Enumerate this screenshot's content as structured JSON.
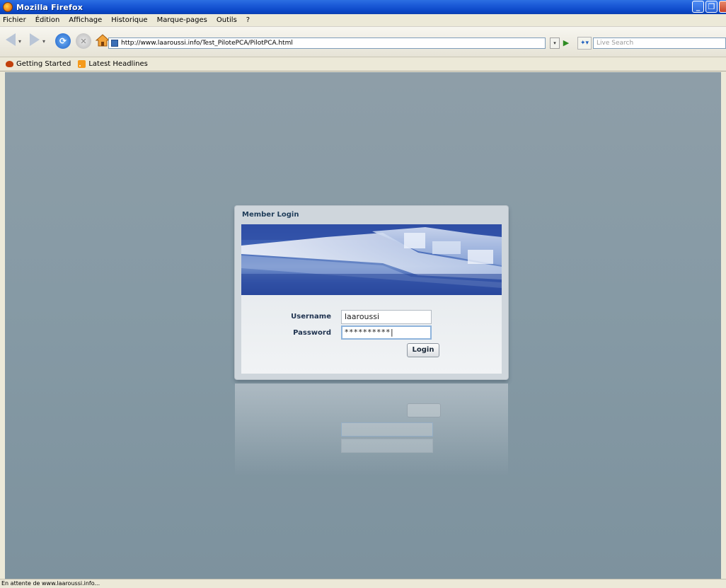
{
  "window": {
    "title": "Mozilla Firefox",
    "buttons": [
      "_",
      "❐",
      "✕"
    ]
  },
  "menubar": {
    "items": [
      "Fichier",
      "Édition",
      "Affichage",
      "Historique",
      "Marque-pages",
      "Outils",
      "?"
    ]
  },
  "toolbar": {
    "url": "http://www.laaroussi.info/Test_PilotePCA/PilotPCA.html",
    "search_placeholder": "Live Search"
  },
  "bookmarks": {
    "items": [
      "Getting Started",
      "Latest Headlines"
    ]
  },
  "login": {
    "title": "Member Login",
    "username_label": "Username",
    "username_value": "laaroussi",
    "password_label": "Password",
    "password_value": "**********|",
    "button_label": "Login"
  },
  "status": {
    "text": "En attente de www.laaroussi.info..."
  },
  "colors": {
    "titlebar": "#0a46c6",
    "content_bg": "#869aa5",
    "panel_bg": "#cfd6dc",
    "label_color": "#1f3350"
  },
  "icons": {
    "app": "firefox-icon",
    "back": "back-arrow-icon",
    "forward": "forward-arrow-icon",
    "reload": "reload-icon",
    "stop": "stop-icon",
    "home": "home-icon",
    "go": "go-arrow-icon",
    "search_engine": "live-search-icon",
    "rss": "rss-icon"
  }
}
